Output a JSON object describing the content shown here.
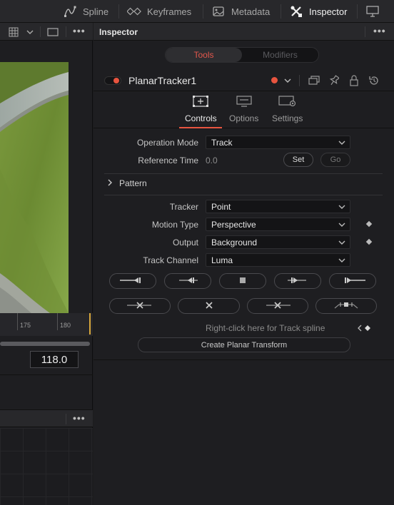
{
  "toolbar": {
    "items": [
      {
        "label": "Spline",
        "icon": "spline-icon"
      },
      {
        "label": "Keyframes",
        "icon": "keyframes-icon"
      },
      {
        "label": "Metadata",
        "icon": "metadata-icon"
      },
      {
        "label": "Inspector",
        "icon": "inspector-icon"
      }
    ],
    "active": "Inspector"
  },
  "viewer": {
    "ruler_labels": [
      "175",
      "180"
    ],
    "frame_value": "118.0"
  },
  "inspector": {
    "title": "Inspector",
    "segment": {
      "tools": "Tools",
      "modifiers": "Modifiers"
    },
    "tool_name": "PlanarTracker1",
    "tabs": [
      {
        "label": "Controls",
        "icon": "controls-icon"
      },
      {
        "label": "Options",
        "icon": "options-icon"
      },
      {
        "label": "Settings",
        "icon": "settings-icon"
      }
    ],
    "operation_mode": {
      "label": "Operation Mode",
      "value": "Track"
    },
    "reference_time": {
      "label": "Reference Time",
      "value": "0.0",
      "set": "Set",
      "go": "Go"
    },
    "pattern_section": "Pattern",
    "tracker": {
      "label": "Tracker",
      "value": "Point"
    },
    "motion_type": {
      "label": "Motion Type",
      "value": "Perspective"
    },
    "output": {
      "label": "Output",
      "value": "Background"
    },
    "track_channel": {
      "label": "Track Channel",
      "value": "Luma"
    },
    "spline_hint": "Right-click here for Track spline",
    "create_button": "Create Planar Transform"
  },
  "colors": {
    "accent": "#e8543f",
    "panel": "#1e1e21",
    "header": "#28282b"
  }
}
